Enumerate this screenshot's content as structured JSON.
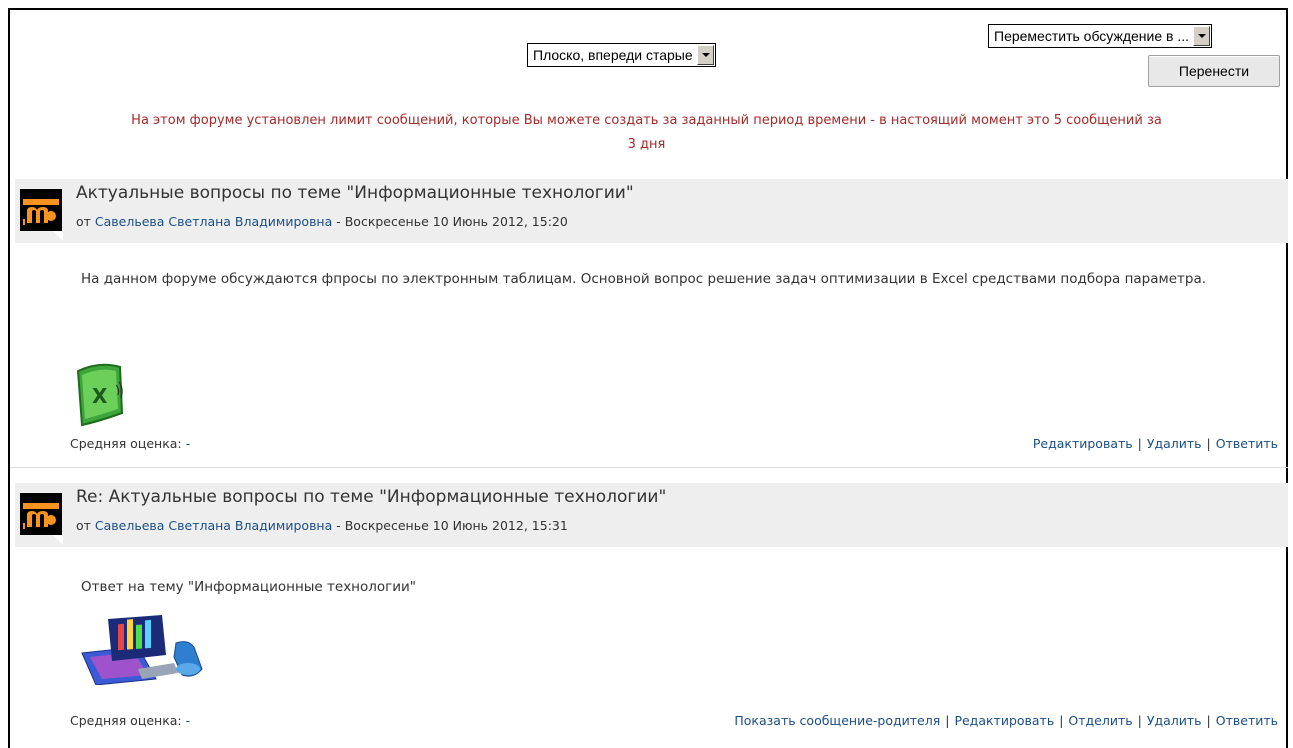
{
  "controls": {
    "display_mode_value": "Плоско, впереди старые",
    "move_discussion_value": "Переместить обсуждение в ...",
    "move_button_label": "Перенести"
  },
  "notice": {
    "line1": "На этом форуме установлен лимит сообщений, которые Вы можете создать за заданный период времени - в настоящий момент это 5 сообщений за",
    "line2": "3 дня"
  },
  "posts": [
    {
      "subject": "Актуальные вопросы по теме \"Информационные технологии\"",
      "by_prefix": "от",
      "author": "Савельева Светлана Владимировна",
      "date": " - Воскресенье 10 Июнь 2012, 15:20",
      "body": "На данном форуме обсуждаются фпросы по электронным таблицам. Основной вопрос решение задач оптимизации в Excel средствами подбора параметра.",
      "rating_label": "Средняя оценка:",
      "rating_value": "-",
      "actions": [
        "Редактировать",
        "Удалить",
        "Ответить"
      ]
    },
    {
      "subject": "Re: Актуальные вопросы по теме \"Информационные технологии\"",
      "by_prefix": "от",
      "author": "Савельева Светлана Владимировна",
      "date": " - Воскресенье 10 Июнь 2012, 15:31",
      "body": "Ответ на тему \"Информационные технологии\"",
      "rating_label": "Средняя оценка:",
      "rating_value": "-",
      "actions": [
        "Показать сообщение-родителя",
        "Редактировать",
        "Отделить",
        "Удалить",
        "Ответить"
      ]
    }
  ],
  "colors": {
    "notice": "#a52a2a",
    "link": "#1a4e87",
    "header_bg": "#eeeeee"
  }
}
